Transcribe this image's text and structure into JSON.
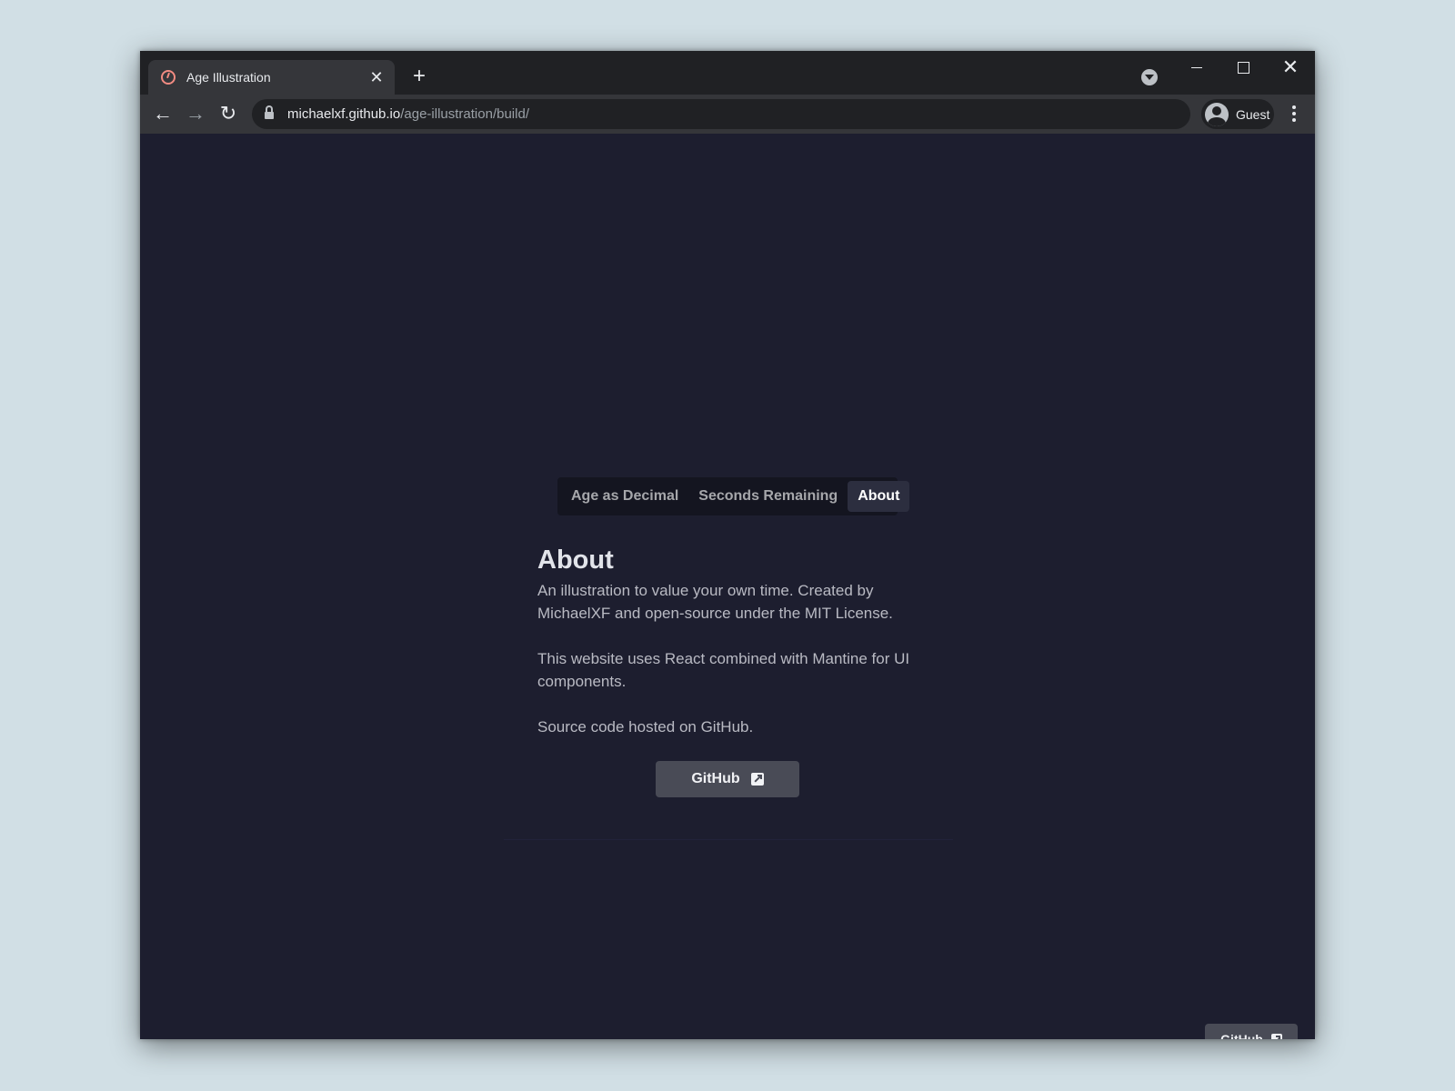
{
  "browser": {
    "tab_title": "Age Illustration",
    "tab_close": "✕",
    "new_tab": "+",
    "url_host": "michaelxf.github.io",
    "url_path": "/age-illustration/build/",
    "profile_label": "Guest",
    "nav_back": "←",
    "nav_forward": "→",
    "nav_reload": "↻",
    "win_close": "✕"
  },
  "tabs": [
    {
      "label": "Age as Decimal",
      "active": false
    },
    {
      "label": "Seconds Remaining",
      "active": false
    },
    {
      "label": "About",
      "active": true
    }
  ],
  "about": {
    "title": "About",
    "paragraphs": [
      "An illustration to value your own time. Created by MichaelXF and open-source under the MIT License.",
      "This website uses React combined with Mantine for UI components.",
      "Source code hosted on GitHub."
    ],
    "button_label": "GitHub"
  },
  "footer": {
    "button_label": "GitHub"
  },
  "colors": {
    "page_bg": "#1d1e2f",
    "chrome_bg": "#202124",
    "toolbar_bg": "#35363a",
    "button_bg": "#494b56"
  }
}
